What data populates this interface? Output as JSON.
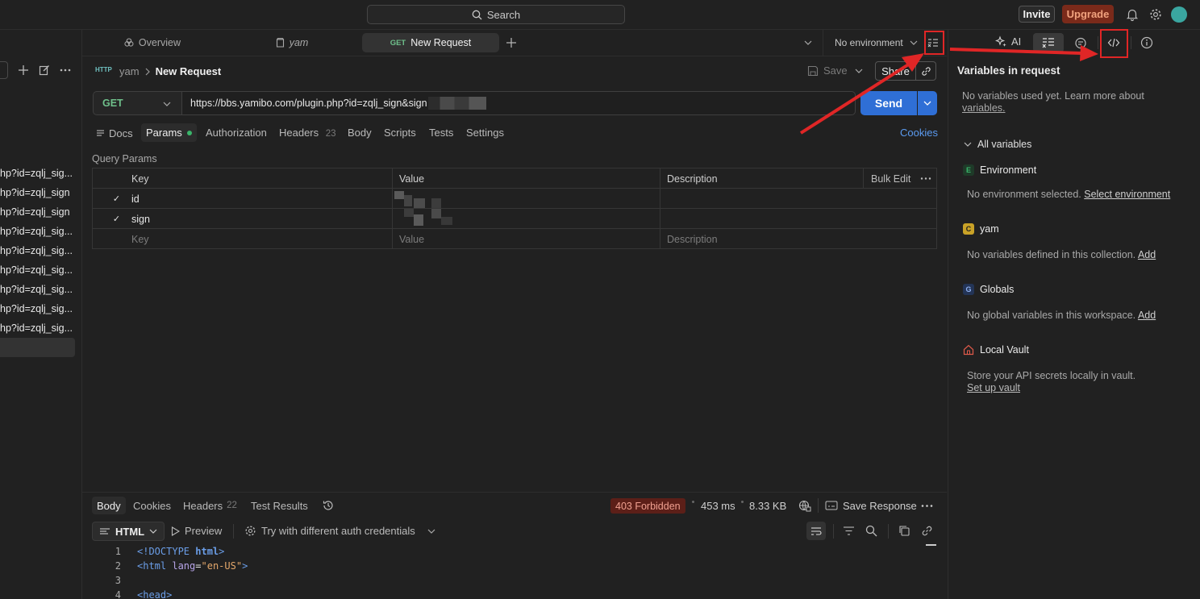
{
  "topbar": {
    "search_label": "Search",
    "invite_label": "Invite",
    "upgrade_label": "Upgrade"
  },
  "sidebar": {
    "items": [
      "hp?id=zqlj_sig...",
      "hp?id=zqlj_sign",
      "hp?id=zqlj_sign",
      "hp?id=zqlj_sig...",
      "hp?id=zqlj_sig...",
      "hp?id=zqlj_sig...",
      "hp?id=zqlj_sig...",
      "hp?id=zqlj_sig...",
      "hp?id=zqlj_sig..."
    ]
  },
  "tabs": {
    "overview": "Overview",
    "yam": "yam",
    "active_method": "GET",
    "active_label": "New Request",
    "environment": "No environment"
  },
  "request": {
    "breadcrumb_collection": "yam",
    "breadcrumb_request": "New Request",
    "save_label": "Save",
    "share_label": "Share",
    "method": "GET",
    "url": "https://bbs.yamibo.com/plugin.php?id=zqlj_sign&sign",
    "send_label": "Send",
    "subtabs": {
      "docs": "Docs",
      "params": "Params",
      "authorization": "Authorization",
      "headers": "Headers",
      "headers_count": "23",
      "body": "Body",
      "scripts": "Scripts",
      "tests": "Tests",
      "settings": "Settings",
      "cookies": "Cookies"
    },
    "query_params_title": "Query Params",
    "table": {
      "headers": [
        "Key",
        "Value",
        "Description"
      ],
      "bulk_edit": "Bulk Edit",
      "rows": [
        {
          "key": "id",
          "checked": true
        },
        {
          "key": "sign",
          "checked": true
        }
      ],
      "placeholder": {
        "key": "Key",
        "value": "Value",
        "description": "Description"
      }
    }
  },
  "response": {
    "tabs": {
      "body": "Body",
      "cookies": "Cookies",
      "headers": "Headers",
      "headers_count": "22",
      "test_results": "Test Results"
    },
    "status": "403 Forbidden",
    "time": "453 ms",
    "size": "8.33 KB",
    "save_response": "Save Response",
    "format": "HTML",
    "preview": "Preview",
    "auth_try": "Try with different auth credentials",
    "code_lines": [
      {
        "num": "1",
        "parts": [
          [
            "tag",
            "<!DOCTYPE "
          ],
          [
            "tag2",
            "html"
          ],
          [
            "tag",
            ">"
          ]
        ]
      },
      {
        "num": "2",
        "parts": [
          [
            "tag",
            "<html "
          ],
          [
            "attr",
            "lang"
          ],
          [
            "plain",
            "="
          ],
          [
            "str",
            "\"en-US\""
          ],
          [
            "tag",
            ">"
          ]
        ]
      },
      {
        "num": "3",
        "parts": []
      },
      {
        "num": "4",
        "parts": [
          [
            "tag",
            "<head>"
          ]
        ]
      }
    ]
  },
  "rpanel": {
    "ai_label": "AI",
    "title": "Variables in request",
    "no_vars_line1": "No variables used yet. Learn more about",
    "no_vars_link": "variables.",
    "all_variables": "All variables",
    "env": {
      "badge": "E",
      "name": "Environment",
      "desc": "No environment selected.",
      "link": "Select environment",
      "color": "#3ab56a"
    },
    "yam": {
      "badge": "C",
      "name": "yam",
      "desc": "No variables defined in this collection.",
      "link": "Add",
      "color": "#c9a227"
    },
    "globals": {
      "badge": "G",
      "name": "Globals",
      "desc": "No global variables in this workspace.",
      "link": "Add",
      "color": "#4a7ad8"
    },
    "vault": {
      "name": "Local Vault",
      "desc": "Store your API secrets locally in vault.",
      "link": "Set up vault"
    }
  },
  "colors": {
    "accent_send": "#2f6fd6",
    "get_green": "#6fc08b",
    "status_red": "#5c1f18",
    "annotation_red": "#e02626"
  }
}
